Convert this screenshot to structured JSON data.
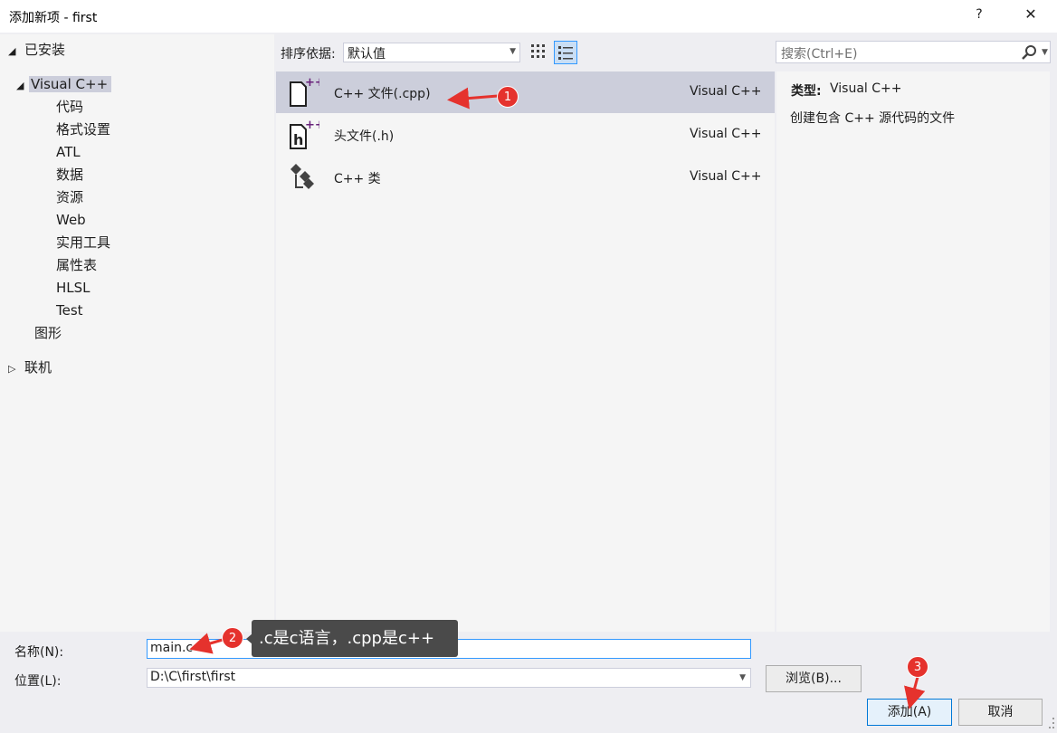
{
  "window": {
    "title": "添加新项 - first",
    "help_label": "?",
    "close_label": "✕"
  },
  "tree": {
    "installed_label": "已安装",
    "visual_cpp_label": "Visual C++",
    "children": [
      "代码",
      "格式设置",
      "ATL",
      "数据",
      "资源",
      "Web",
      "实用工具",
      "属性表",
      "HLSL",
      "Test"
    ],
    "graphics_label": "图形",
    "online_label": "联机"
  },
  "toolbar": {
    "sort_label": "排序依据:",
    "sort_value": "默认值"
  },
  "templates": [
    {
      "name": "C++ 文件(.cpp)",
      "category": "Visual C++",
      "icon": "cpp-file-icon"
    },
    {
      "name": "头文件(.h)",
      "category": "Visual C++",
      "icon": "header-file-icon"
    },
    {
      "name": "C++ 类",
      "category": "Visual C++",
      "icon": "cpp-class-icon"
    }
  ],
  "search": {
    "placeholder": "搜索(Ctrl+E)"
  },
  "details": {
    "type_label": "类型:",
    "type_value": "Visual C++",
    "description": "创建包含 C++ 源代码的文件"
  },
  "form": {
    "name_label": "名称(N):",
    "name_value": "main.c",
    "location_label": "位置(L):",
    "location_value": "D:\\C\\first\\first",
    "browse_label": "浏览(B)...",
    "add_label": "添加(A)",
    "cancel_label": "取消"
  },
  "annotations": {
    "badge1": "1",
    "badge2": "2",
    "badge3": "3",
    "tooltip": ".c是c语言，.cpp是c++",
    "color": "#e5322d"
  }
}
